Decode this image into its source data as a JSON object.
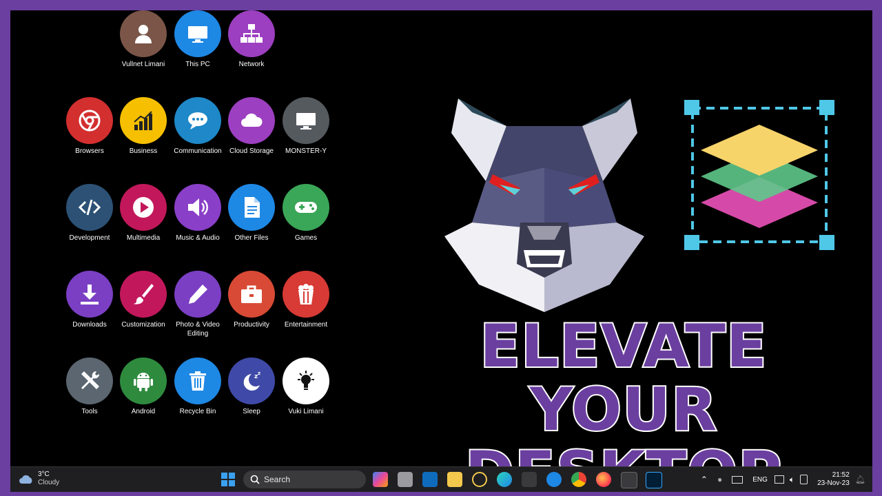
{
  "desktop_icons": [
    {
      "label": "Vullnet Limani",
      "color": "#7a5548",
      "icon": "user-icon"
    },
    {
      "label": "This PC",
      "color": "#1e88e5",
      "icon": "monitor-icon"
    },
    {
      "label": "Network",
      "color": "#9c3fc0",
      "icon": "network-icon"
    },
    {
      "label": "Browsers",
      "color": "#d32f2f",
      "icon": "chrome-icon"
    },
    {
      "label": "Business",
      "color": "#f6c000",
      "icon": "bar-chart-icon"
    },
    {
      "label": "Communication",
      "color": "#1e88c8",
      "icon": "chat-icon"
    },
    {
      "label": "Cloud Storage",
      "color": "#9c3fc0",
      "icon": "cloud-icon"
    },
    {
      "label": "MONSTER-Y",
      "color": "#555a5f",
      "icon": "monitor-icon"
    },
    {
      "label": "Development",
      "color": "#2c5175",
      "icon": "code-icon"
    },
    {
      "label": "Multimedia",
      "color": "#c2185b",
      "icon": "play-icon"
    },
    {
      "label": "Music & Audio",
      "color": "#8a3fc8",
      "icon": "speaker-icon"
    },
    {
      "label": "Other Files",
      "color": "#1e88e5",
      "icon": "document-icon"
    },
    {
      "label": "Games",
      "color": "#3aa657",
      "icon": "gamepad-icon"
    },
    {
      "label": "Downloads",
      "color": "#7b3fc4",
      "icon": "download-icon"
    },
    {
      "label": "Customization",
      "color": "#c2185b",
      "icon": "brush-icon"
    },
    {
      "label": "Photo & Video Editing",
      "color": "#7b3fc4",
      "icon": "pencil-icon"
    },
    {
      "label": "Productivity",
      "color": "#d84a35",
      "icon": "briefcase-icon"
    },
    {
      "label": "Entertainment",
      "color": "#d83a35",
      "icon": "popcorn-icon"
    },
    {
      "label": "Tools",
      "color": "#5b6670",
      "icon": "tools-icon"
    },
    {
      "label": "Android",
      "color": "#2e8b3e",
      "icon": "android-icon"
    },
    {
      "label": "Recycle Bin",
      "color": "#1e88e5",
      "icon": "recycle-bin-icon"
    },
    {
      "label": "Sleep",
      "color": "#3f4aa8",
      "icon": "moon-icon"
    },
    {
      "label": "Vuki Limani",
      "color": "#ffffff",
      "icon": "lightbulb-icon"
    }
  ],
  "headline": {
    "line1": "ELEVATE YOUR",
    "line2": "DESKTOP"
  },
  "colors": {
    "frame": "#6b3fa0",
    "headline_fill": "#6b3fa0",
    "headline_stroke": "#ffffff",
    "taskbar": "#1f1f22"
  },
  "taskbar": {
    "weather": {
      "temp": "3°C",
      "condition": "Cloudy"
    },
    "search_placeholder": "Search",
    "apps": [
      "copilot-icon",
      "task-view-icon",
      "outlook-icon",
      "file-explorer-icon",
      "cursor-app-icon",
      "edge-icon",
      "terminal-icon",
      "app-store-icon",
      "chrome-icon",
      "firefox-icon",
      "snipping-tool-icon",
      "photoshop-icon"
    ],
    "tray": {
      "language": "ENG",
      "time": "21:52",
      "date": "23-Nov-23"
    }
  }
}
